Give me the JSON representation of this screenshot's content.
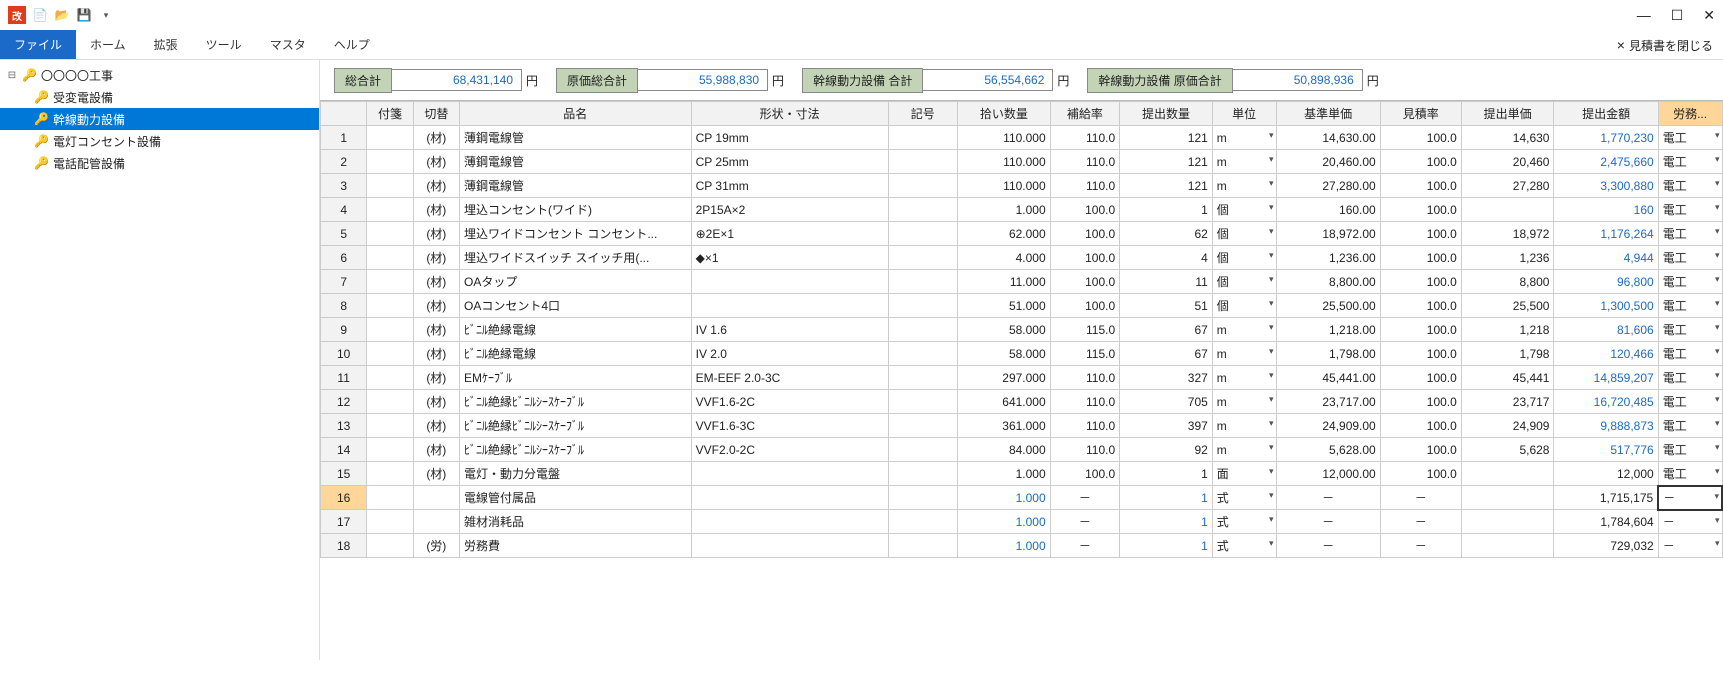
{
  "menu": {
    "file": "ファイル",
    "home": "ホーム",
    "ext": "拡張",
    "tool": "ツール",
    "master": "マスタ",
    "help": "ヘルプ"
  },
  "close_estimate": "見積書を閉じる",
  "tree": {
    "root": "〇〇〇〇工事",
    "n1": "受変電設備",
    "n2": "幹線動力設備",
    "n3": "電灯コンセント設備",
    "n4": "電話配管設備"
  },
  "summary": {
    "s1_label": "総合計",
    "s1_val": "68,431,140",
    "s2_label": "原価総合計",
    "s2_val": "55,988,830",
    "s3_label": "幹線動力設備 合計",
    "s3_val": "56,554,662",
    "s4_label": "幹線動力設備 原価合計",
    "s4_val": "50,898,936",
    "yen": "円"
  },
  "headers": {
    "tag": "付箋",
    "sw": "切替",
    "name": "品名",
    "shape": "形状・寸法",
    "sym": "記号",
    "qty": "拾い数量",
    "rate": "補給率",
    "sqty": "提出数量",
    "unit": "単位",
    "bprice": "基準単価",
    "erate": "見積率",
    "sprice": "提出単価",
    "amount": "提出金額",
    "labor": "労務..."
  },
  "rows": [
    {
      "n": "1",
      "sw": "(材)",
      "name": "薄鋼電線管",
      "shape": "CP 19mm",
      "sym": "",
      "qty": "110.000",
      "rate": "110.0",
      "sqty": "121",
      "unit": "m",
      "bprice": "14,630.00",
      "erate": "100.0",
      "sprice": "14,630",
      "amount": "1,770,230",
      "labor": "電工"
    },
    {
      "n": "2",
      "sw": "(材)",
      "name": "薄鋼電線管",
      "shape": "CP 25mm",
      "sym": "",
      "qty": "110.000",
      "rate": "110.0",
      "sqty": "121",
      "unit": "m",
      "bprice": "20,460.00",
      "erate": "100.0",
      "sprice": "20,460",
      "amount": "2,475,660",
      "labor": "電工"
    },
    {
      "n": "3",
      "sw": "(材)",
      "name": "薄鋼電線管",
      "shape": "CP 31mm",
      "sym": "",
      "qty": "110.000",
      "rate": "110.0",
      "sqty": "121",
      "unit": "m",
      "bprice": "27,280.00",
      "erate": "100.0",
      "sprice": "27,280",
      "amount": "3,300,880",
      "labor": "電工"
    },
    {
      "n": "4",
      "sw": "(材)",
      "name": "埋込コンセント(ワイド)",
      "shape": "2P15A×2",
      "sym": "",
      "qty": "1.000",
      "rate": "100.0",
      "sqty": "1",
      "unit": "個",
      "bprice": "160.00",
      "erate": "100.0",
      "sprice": "",
      "amount": "160",
      "labor": "電工"
    },
    {
      "n": "5",
      "sw": "(材)",
      "name": "埋込ワイドコンセント コンセント...",
      "shape": "⊕2E×1",
      "sym": "",
      "qty": "62.000",
      "rate": "100.0",
      "sqty": "62",
      "unit": "個",
      "bprice": "18,972.00",
      "erate": "100.0",
      "sprice": "18,972",
      "amount": "1,176,264",
      "labor": "電工"
    },
    {
      "n": "6",
      "sw": "(材)",
      "name": "埋込ワイドスイッチ スイッチ用(...",
      "shape": "◆×1",
      "sym": "",
      "qty": "4.000",
      "rate": "100.0",
      "sqty": "4",
      "unit": "個",
      "bprice": "1,236.00",
      "erate": "100.0",
      "sprice": "1,236",
      "amount": "4,944",
      "labor": "電工"
    },
    {
      "n": "7",
      "sw": "(材)",
      "name": "OAタップ",
      "shape": "",
      "sym": "",
      "qty": "11.000",
      "rate": "100.0",
      "sqty": "11",
      "unit": "個",
      "bprice": "8,800.00",
      "erate": "100.0",
      "sprice": "8,800",
      "amount": "96,800",
      "labor": "電工"
    },
    {
      "n": "8",
      "sw": "(材)",
      "name": "OAコンセント4口",
      "shape": "",
      "sym": "",
      "qty": "51.000",
      "rate": "100.0",
      "sqty": "51",
      "unit": "個",
      "bprice": "25,500.00",
      "erate": "100.0",
      "sprice": "25,500",
      "amount": "1,300,500",
      "labor": "電工"
    },
    {
      "n": "9",
      "sw": "(材)",
      "name": "ﾋﾞﾆﾙ絶縁電線",
      "shape": "IV 1.6",
      "sym": "",
      "qty": "58.000",
      "rate": "115.0",
      "sqty": "67",
      "unit": "m",
      "bprice": "1,218.00",
      "erate": "100.0",
      "sprice": "1,218",
      "amount": "81,606",
      "labor": "電工"
    },
    {
      "n": "10",
      "sw": "(材)",
      "name": "ﾋﾞﾆﾙ絶縁電線",
      "shape": "IV 2.0",
      "sym": "",
      "qty": "58.000",
      "rate": "115.0",
      "sqty": "67",
      "unit": "m",
      "bprice": "1,798.00",
      "erate": "100.0",
      "sprice": "1,798",
      "amount": "120,466",
      "labor": "電工"
    },
    {
      "n": "11",
      "sw": "(材)",
      "name": "EMｹｰﾌﾞﾙ",
      "shape": "EM-EEF 2.0-3C",
      "sym": "",
      "qty": "297.000",
      "rate": "110.0",
      "sqty": "327",
      "unit": "m",
      "bprice": "45,441.00",
      "erate": "100.0",
      "sprice": "45,441",
      "amount": "14,859,207",
      "labor": "電工"
    },
    {
      "n": "12",
      "sw": "(材)",
      "name": "ﾋﾞﾆﾙ絶縁ﾋﾞﾆﾙｼｰｽｹｰﾌﾞﾙ",
      "shape": "VVF1.6-2C",
      "sym": "",
      "qty": "641.000",
      "rate": "110.0",
      "sqty": "705",
      "unit": "m",
      "bprice": "23,717.00",
      "erate": "100.0",
      "sprice": "23,717",
      "amount": "16,720,485",
      "labor": "電工"
    },
    {
      "n": "13",
      "sw": "(材)",
      "name": "ﾋﾞﾆﾙ絶縁ﾋﾞﾆﾙｼｰｽｹｰﾌﾞﾙ",
      "shape": "VVF1.6-3C",
      "sym": "",
      "qty": "361.000",
      "rate": "110.0",
      "sqty": "397",
      "unit": "m",
      "bprice": "24,909.00",
      "erate": "100.0",
      "sprice": "24,909",
      "amount": "9,888,873",
      "labor": "電工"
    },
    {
      "n": "14",
      "sw": "(材)",
      "name": "ﾋﾞﾆﾙ絶縁ﾋﾞﾆﾙｼｰｽｹｰﾌﾞﾙ",
      "shape": "VVF2.0-2C",
      "sym": "",
      "qty": "84.000",
      "rate": "110.0",
      "sqty": "92",
      "unit": "m",
      "bprice": "5,628.00",
      "erate": "100.0",
      "sprice": "5,628",
      "amount": "517,776",
      "labor": "電工"
    },
    {
      "n": "15",
      "sw": "(材)",
      "name": "電灯・動力分電盤",
      "shape": "",
      "sym": "",
      "qty": "1.000",
      "rate": "100.0",
      "sqty": "1",
      "unit": "面",
      "bprice": "12,000.00",
      "erate": "100.0",
      "sprice": "",
      "amount": "12,000",
      "labor": "電工"
    },
    {
      "n": "16",
      "sw": "",
      "name": "電線管付属品",
      "shape": "",
      "sym": "",
      "qty": "1.000",
      "rate": "－",
      "sqty": "1",
      "unit": "式",
      "bprice": "－",
      "erate": "－",
      "sprice": "",
      "amount": "1,715,175",
      "labor": "－",
      "sel": true,
      "qblue": true,
      "laborBox": true
    },
    {
      "n": "17",
      "sw": "",
      "name": "雑材消耗品",
      "shape": "",
      "sym": "",
      "qty": "1.000",
      "rate": "－",
      "sqty": "1",
      "unit": "式",
      "bprice": "－",
      "erate": "－",
      "sprice": "",
      "amount": "1,784,604",
      "labor": "－",
      "qblue": true
    },
    {
      "n": "18",
      "sw": "(労)",
      "name": "労務費",
      "shape": "",
      "sym": "",
      "qty": "1.000",
      "rate": "－",
      "sqty": "1",
      "unit": "式",
      "bprice": "－",
      "erate": "－",
      "sprice": "",
      "amount": "729,032",
      "labor": "－",
      "qblue": true
    }
  ]
}
